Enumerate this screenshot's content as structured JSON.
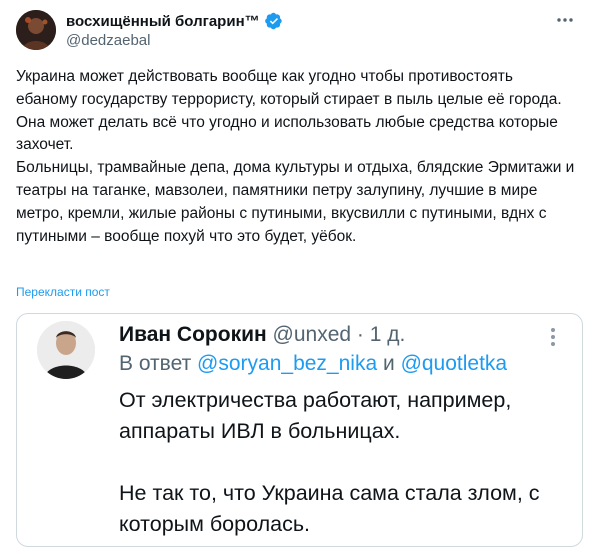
{
  "tweet": {
    "author": {
      "display_name": "восхищённый болгарин™",
      "handle": "@dedzaebal",
      "verified": true,
      "avatar_icon": "user-avatar-icon"
    },
    "paragraphs": [
      "Украина может действовать вообще как угодно чтобы противостоять ебаному государству террористу, который стирает в пыль целые её города.",
      "Она может делать всё что угодно и использовать любые средства которые захочет.",
      "Больницы, трамвайные депа, дома культуры и отдыха, блядские Эрмитажи и театры на таганке, мавзолеи, памятники петру залупину, лучшие в мире метро, кремли, жилые районы с путиными, вкусвилли с путиными, вднх с путиными – вообще похуй что это будет, уёбок."
    ],
    "translate_label": "Перекласти пост"
  },
  "quote": {
    "author_name": "Иван Сорокин",
    "author_handle": "@unxed",
    "separator": "·",
    "time": "1 д.",
    "reply_prefix": "В ответ",
    "reply_mention_1": "@soryan_bez_nika",
    "reply_and": "и",
    "reply_mention_2": "@quotletka",
    "paragraphs": [
      "От электричества работают, например, аппараты ИВЛ в больницах.",
      "Не так то, что Украина сама стала злом, с которым боролась."
    ]
  },
  "colors": {
    "accent": "#1d9bf0",
    "text": "#0f1419",
    "muted": "#536471",
    "border": "#cfd9de"
  }
}
